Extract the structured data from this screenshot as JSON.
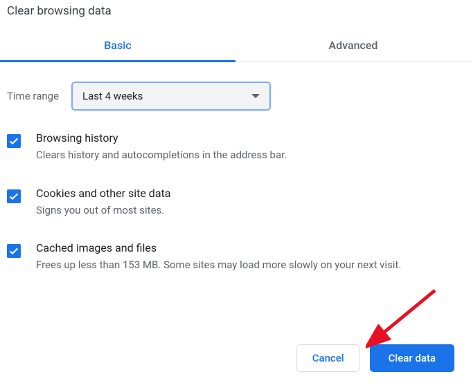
{
  "title": "Clear browsing data",
  "tabs": {
    "basic": "Basic",
    "advanced": "Advanced"
  },
  "range": {
    "label": "Time range",
    "value": "Last 4 weeks"
  },
  "options": [
    {
      "title": "Browsing history",
      "desc": "Clears history and autocompletions in the address bar."
    },
    {
      "title": "Cookies and other site data",
      "desc": "Signs you out of most sites."
    },
    {
      "title": "Cached images and files",
      "desc": "Frees up less than 153 MB. Some sites may load more slowly on your next visit."
    }
  ],
  "buttons": {
    "cancel": "Cancel",
    "clear": "Clear data"
  }
}
